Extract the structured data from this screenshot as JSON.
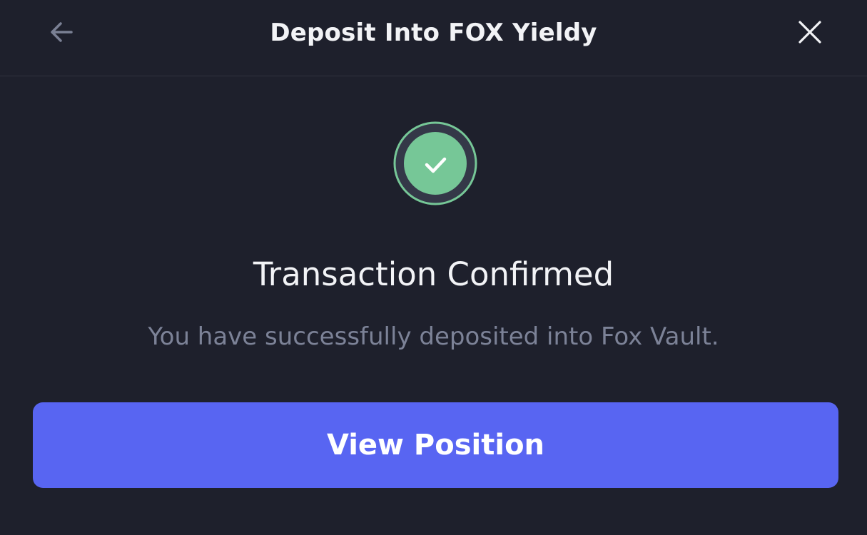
{
  "header": {
    "title": "Deposit Into FOX Yieldy",
    "back_icon": "arrow-left-icon",
    "close_icon": "close-icon"
  },
  "status": {
    "icon": "check-circle-icon",
    "title": "Transaction Confirmed",
    "message": "You have successfully deposited into Fox Vault."
  },
  "actions": {
    "view_position_label": "View Position"
  },
  "colors": {
    "background": "#1e202c",
    "accent": "#5865f2",
    "success": "#76c797",
    "muted_text": "#7c8297"
  }
}
